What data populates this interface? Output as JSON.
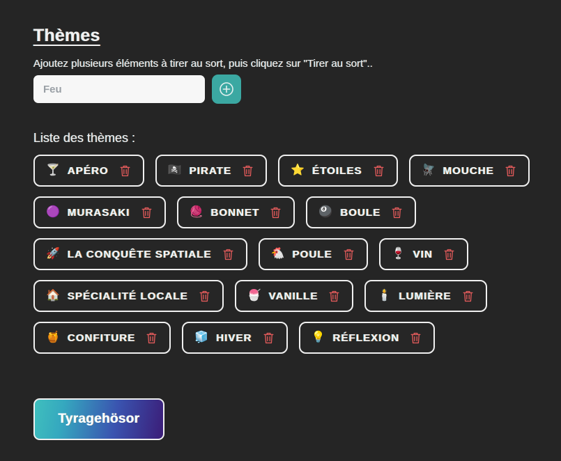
{
  "page": {
    "background_color": "#252525",
    "title": "Thèmes",
    "subtitle": "Ajoutez plusieurs éléments à tirer au sort, puis cliquez sur \"Tirer au sort\".."
  },
  "input_row": {
    "placeholder": "Feu",
    "value": "",
    "add_button": {
      "icon": "circle-plus-icon",
      "color": "#3ba8a2"
    }
  },
  "list": {
    "heading": "Liste des thèmes :",
    "delete_icon": "trash-icon",
    "delete_icon_color": "#e05a5a",
    "items": [
      {
        "emoji": "🍸",
        "label": "APÉRO"
      },
      {
        "emoji": "🏴‍☠️",
        "label": "PIRATE"
      },
      {
        "emoji": "⭐",
        "label": "ÉTOILES"
      },
      {
        "emoji": "🪰",
        "label": "MOUCHE"
      },
      {
        "emoji": "🟣",
        "label": "MURASAKI"
      },
      {
        "emoji": "🧶",
        "label": "BONNET"
      },
      {
        "emoji": "🎱",
        "label": "BOULE"
      },
      {
        "emoji": "🚀",
        "label": "LA CONQUÊTE SPATIALE"
      },
      {
        "emoji": "🐔",
        "label": "POULE"
      },
      {
        "emoji": "🍷",
        "label": "VIN"
      },
      {
        "emoji": "🏠",
        "label": "SPÉCIALITÉ LOCALE"
      },
      {
        "emoji": "🍧",
        "label": "VANILLE"
      },
      {
        "emoji": "🕯️",
        "label": "LUMIÈRE"
      },
      {
        "emoji": "🍯",
        "label": "CONFITURE"
      },
      {
        "emoji": "🧊",
        "label": "HIVER"
      },
      {
        "emoji": "💡",
        "label": "RÉFLEXION"
      }
    ]
  },
  "draw_button": {
    "label": "Tyragehösor",
    "gradient_from": "#3fbfbd",
    "gradient_to": "#3b1d78"
  }
}
